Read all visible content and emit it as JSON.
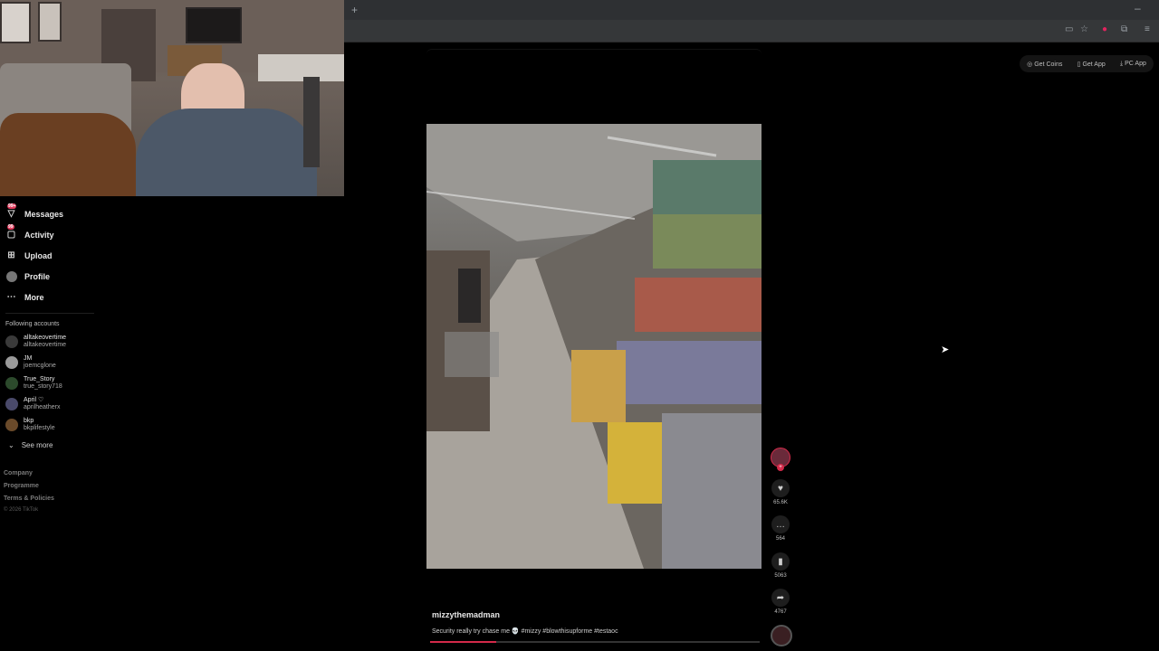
{
  "browser": {
    "new_tab": "+",
    "minimize": "–",
    "toolbar_icons": [
      "screen-icon",
      "star-icon",
      "pinterest-icon",
      "extensions-icon",
      "menu-icon"
    ]
  },
  "top_links": [
    {
      "icon": "coin-icon",
      "label": "Get Coins"
    },
    {
      "icon": "phone-icon",
      "label": "Get App"
    },
    {
      "icon": "download-icon",
      "label": "PC App"
    }
  ],
  "sidebar": {
    "items": [
      {
        "label": "Messages",
        "badge": "99+",
        "icon": "messages-icon"
      },
      {
        "label": "Activity",
        "badge": "99",
        "icon": "activity-icon"
      },
      {
        "label": "Upload",
        "badge": "",
        "icon": "upload-icon"
      },
      {
        "label": "Profile",
        "badge": "",
        "icon": "profile-icon"
      },
      {
        "label": "More",
        "badge": "",
        "icon": "more-icon"
      }
    ],
    "following_title": "Following accounts",
    "accounts": [
      {
        "name": "alltakeovertime",
        "handle": "alltakeovertime",
        "color": "#3a3a3a"
      },
      {
        "name": "JM",
        "handle": "joemcglone",
        "color": "#9a9a9a"
      },
      {
        "name": "True_Story",
        "handle": "true_story718",
        "color": "#2c4a2c"
      },
      {
        "name": "April ♡",
        "handle": "aprilheatherx",
        "color": "#4a4a6a"
      },
      {
        "name": "bkp",
        "handle": "bkplifestyle",
        "color": "#6a4a2a"
      }
    ],
    "see_more": "See more",
    "footer": [
      "Company",
      "Programme",
      "Terms & Policies"
    ],
    "copyright": "© 2026 TikTok"
  },
  "video": {
    "author": "mizzythemadman",
    "caption": "Security really try chase me 💀 #mizzy #blowthisupforme #testaoc",
    "progress": 0.2,
    "likes": "65.6K",
    "comments": "564",
    "saves": "5063",
    "shares": "4767"
  },
  "colors": {
    "accent": "#d42a4a",
    "badge": "#e03a5c"
  }
}
